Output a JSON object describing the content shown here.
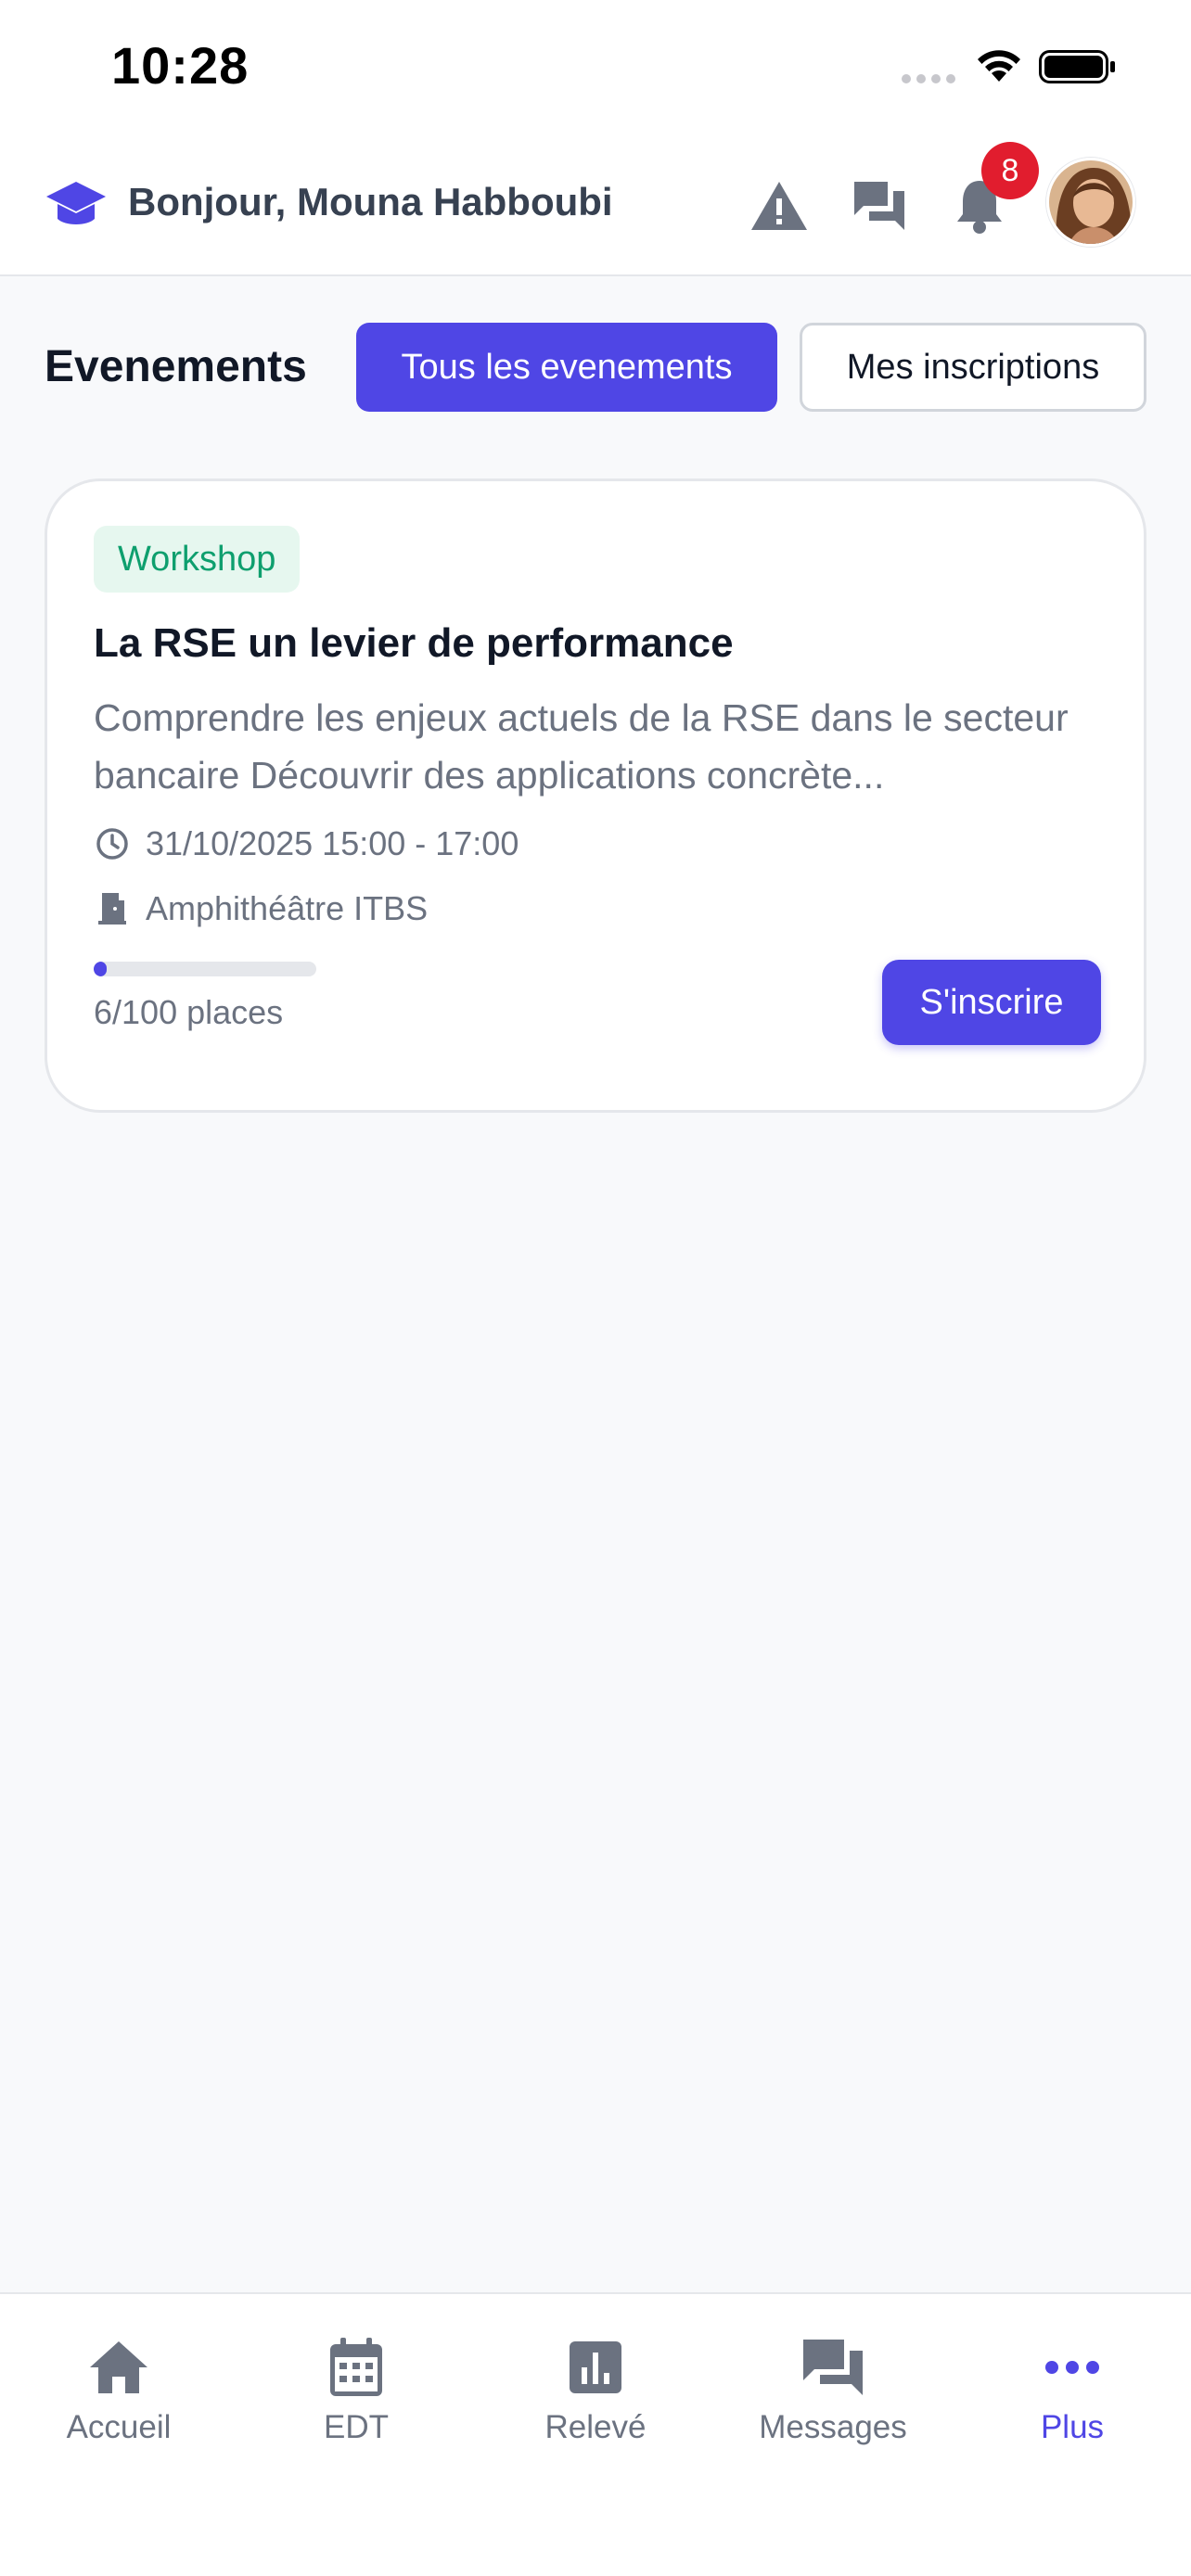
{
  "status_bar": {
    "time": "10:28"
  },
  "header": {
    "greeting": "Bonjour, Mouna Habboubi",
    "notification_count": "8",
    "icons": [
      "warning-icon",
      "chat-icon",
      "bell-icon"
    ]
  },
  "events": {
    "title": "Evenements",
    "tabs": [
      {
        "label": "Tous les evenements",
        "active": true
      },
      {
        "label": "Mes inscriptions",
        "active": false
      }
    ]
  },
  "card": {
    "tag": "Workshop",
    "title": "La RSE un levier de performance",
    "description": "Comprendre les enjeux actuels de la RSE dans le secteur bancaire Découvrir des applications concrète...",
    "date": "31/10/2025 15:00 - 17:00",
    "location": "Amphithéâtre ITBS",
    "places_label": "6/100 places",
    "places_taken": 6,
    "places_total": 100,
    "button": "S'inscrire"
  },
  "nav": {
    "items": [
      {
        "label": "Accueil",
        "icon": "home-icon"
      },
      {
        "label": "EDT",
        "icon": "calendar-icon"
      },
      {
        "label": "Relevé",
        "icon": "chart-icon"
      },
      {
        "label": "Messages",
        "icon": "messages-icon"
      },
      {
        "label": "Plus",
        "icon": "more-icon",
        "active": true
      }
    ]
  },
  "colors": {
    "accent": "#4f46e5",
    "badge": "#e11d2e",
    "tag_text": "#0e9f6e",
    "tag_bg": "#e6f7ef"
  }
}
